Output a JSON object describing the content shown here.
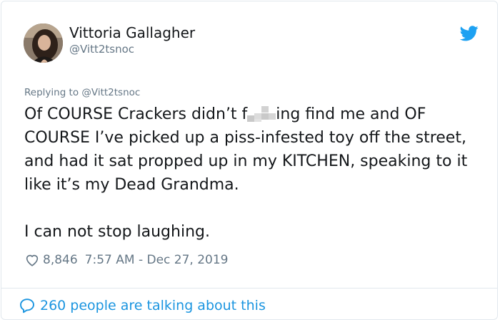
{
  "author": {
    "name": "Vittoria Gallagher",
    "handle": "@Vitt2tsnoc"
  },
  "replying_to": "Replying to @Vitt2tsnoc",
  "tweet": {
    "line1_before": "Of COURSE Crackers didn’t f",
    "line1_after": "ing find me and OF COURSE I’ve picked up a piss-infested toy off the street, and had it sat propped up in my KITCHEN, speaking to it like it’s my Dead Grandma.",
    "paragraph2": "I can not stop laughing."
  },
  "likes": "8,846",
  "timestamp": "7:57 AM - Dec 27, 2019",
  "conversation": "260 people are talking about this",
  "icons": {
    "brand": "twitter-bird-icon",
    "like": "heart-icon",
    "reply": "speech-bubble-icon"
  },
  "colors": {
    "twitter_blue": "#1da1f2",
    "link_blue": "#1b95e0",
    "secondary_text": "#657786"
  }
}
